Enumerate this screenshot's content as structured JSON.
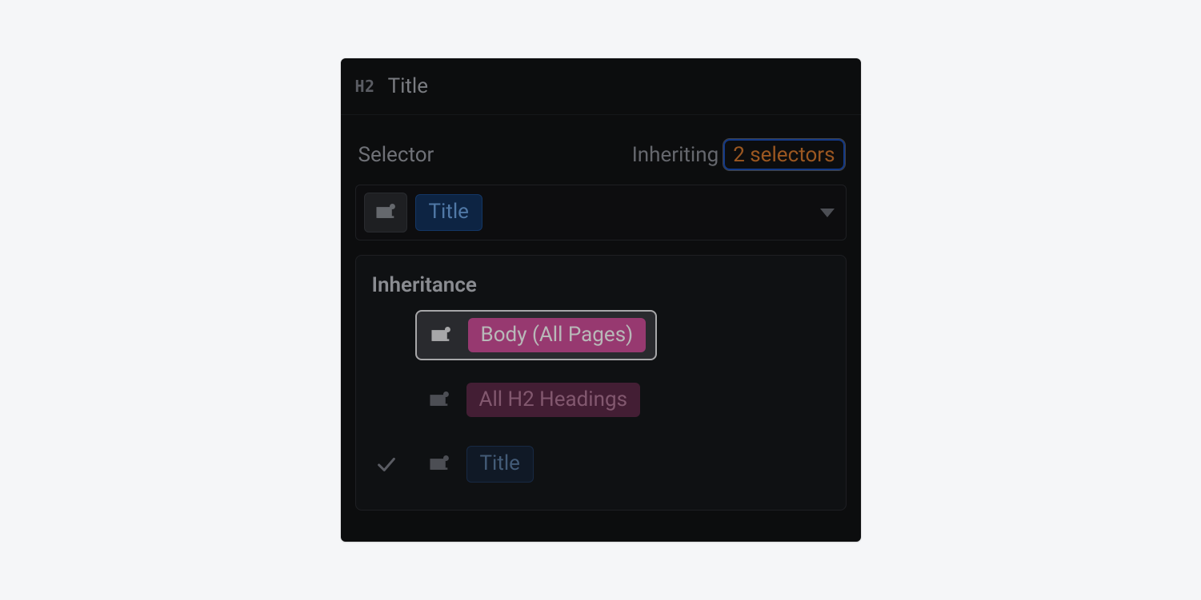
{
  "header": {
    "element_tag": "H2",
    "title": "Title"
  },
  "selector": {
    "label": "Selector",
    "inheriting_label": "Inheriting",
    "inheriting_count_text": "2 selectors",
    "current_class": "Title"
  },
  "inheritance": {
    "title": "Inheritance",
    "items": [
      {
        "label": "Body (All Pages)",
        "kind": "tag",
        "selected": true,
        "checked": false
      },
      {
        "label": "All H2 Headings",
        "kind": "tag",
        "selected": false,
        "checked": false
      },
      {
        "label": "Title",
        "kind": "class",
        "selected": false,
        "checked": true
      }
    ]
  },
  "colors": {
    "accent_orange": "#d7792e",
    "accent_blue": "#1b4fbc",
    "chip_pink": "#d14f9c"
  }
}
